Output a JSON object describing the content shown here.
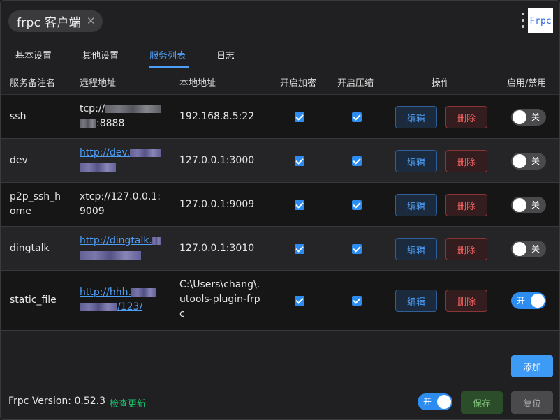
{
  "window": {
    "title": "frpc 客户端",
    "logo_text": "Frpc"
  },
  "tabs": [
    {
      "label": "基本设置"
    },
    {
      "label": "其他设置"
    },
    {
      "label": "服务列表"
    },
    {
      "label": "日志"
    }
  ],
  "active_tab": "服务列表",
  "table": {
    "headers": [
      "服务备注名",
      "远程地址",
      "本地地址",
      "开启加密",
      "开启压缩",
      "操作",
      "启用/禁用"
    ],
    "rows": [
      {
        "name": "ssh",
        "remote_prefix": "tcp://",
        "remote_suffix": ":8888",
        "remote_link": false,
        "local": "192.168.8.5:22",
        "encrypt": true,
        "compress": true,
        "edit_label": "编辑",
        "delete_label": "删除",
        "enabled": false,
        "toggle_label": "关"
      },
      {
        "name": "dev",
        "remote_prefix": "http://dev.",
        "remote_suffix": "",
        "remote_link": true,
        "local": "127.0.0.1:3000",
        "encrypt": true,
        "compress": true,
        "edit_label": "编辑",
        "delete_label": "删除",
        "enabled": false,
        "toggle_label": "关"
      },
      {
        "name": "p2p_ssh_home",
        "remote_prefix": "xtcp://127.0.0.1:9009",
        "remote_suffix": "",
        "remote_link": false,
        "local": "127.0.0.1:9009",
        "encrypt": true,
        "compress": true,
        "edit_label": "编辑",
        "delete_label": "删除",
        "enabled": false,
        "toggle_label": "关"
      },
      {
        "name": "dingtalk",
        "remote_prefix": "http://dingtalk.",
        "remote_suffix": "",
        "remote_link": true,
        "local": "127.0.0.1:3010",
        "encrypt": true,
        "compress": true,
        "edit_label": "编辑",
        "delete_label": "删除",
        "enabled": false,
        "toggle_label": "关"
      },
      {
        "name": "static_file",
        "remote_prefix": "http://hhh.",
        "remote_suffix": "/123/",
        "remote_link": true,
        "local": "C:\\Users\\chang\\.utools-plugin-frpc",
        "encrypt": true,
        "compress": true,
        "edit_label": "编辑",
        "delete_label": "删除",
        "enabled": true,
        "toggle_label": "开"
      }
    ]
  },
  "add_label": "添加",
  "footer": {
    "version": "Frpc Version: 0.52.3",
    "check_update": "检查更新",
    "run_toggle_label": "开",
    "run_enabled": true,
    "save_label": "保存",
    "reset_label": "复位"
  },
  "colors": {
    "accent": "#2d8cf0",
    "link": "#4d9ef7",
    "danger": "#f06060",
    "success": "#19be6b"
  }
}
